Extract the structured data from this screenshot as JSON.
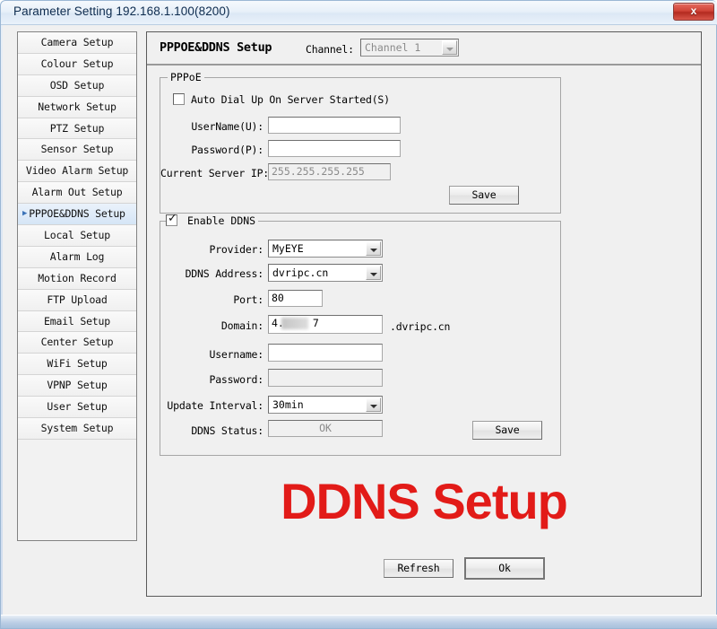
{
  "window": {
    "title": "Parameter Setting 192.168.1.100(8200)",
    "close_label": "x",
    "close_icon": "close-icon"
  },
  "sidebar": {
    "selected_index": 8,
    "marker_glyph": "▶",
    "items": [
      {
        "label": "Camera Setup"
      },
      {
        "label": "Colour Setup"
      },
      {
        "label": "OSD Setup"
      },
      {
        "label": "Network Setup"
      },
      {
        "label": "PTZ Setup"
      },
      {
        "label": "Sensor Setup"
      },
      {
        "label": "Video Alarm Setup"
      },
      {
        "label": "Alarm Out Setup"
      },
      {
        "label": "PPPOE&DDNS Setup"
      },
      {
        "label": "Local Setup"
      },
      {
        "label": "Alarm Log"
      },
      {
        "label": "Motion Record"
      },
      {
        "label": "FTP Upload"
      },
      {
        "label": "Email Setup"
      },
      {
        "label": "Center Setup"
      },
      {
        "label": "WiFi Setup"
      },
      {
        "label": "VPNP Setup"
      },
      {
        "label": "User Setup"
      },
      {
        "label": "System Setup"
      }
    ]
  },
  "content": {
    "page_title": "PPPOE&DDNS Setup",
    "channel_label": "Channel:",
    "channel_value": "Channel 1"
  },
  "pppoe": {
    "group_title": "PPPoE",
    "auto_dial_label": "Auto Dial Up On Server Started(S)",
    "auto_dial_checked": false,
    "username_label": "UserName(U):",
    "username_value": "",
    "password_label": "Password(P):",
    "password_value": "",
    "server_ip_label": "Current Server IP:",
    "server_ip_value": "255.255.255.255",
    "save_label": "Save"
  },
  "ddns": {
    "group_title": "Enable DDNS",
    "enabled": true,
    "check_glyph": "✓",
    "provider_label": "Provider:",
    "provider_value": "MyEYE",
    "address_label": "DDNS Address:",
    "address_value": "dvripc.cn",
    "port_label": "Port:",
    "port_value": "80",
    "domain_label": "Domain:",
    "domain_value_prefix": "4.",
    "domain_value_suffix": "7",
    "domain_suffix_text": ".dvripc.cn",
    "username_label": "Username:",
    "username_value": "",
    "password_label": "Password:",
    "password_value": "",
    "update_interval_label": "Update Interval:",
    "update_interval_value": "30min",
    "status_label": "DDNS Status:",
    "status_value": "OK",
    "save_label": "Save"
  },
  "annotation": {
    "text": "DDNS Setup",
    "color": "#e21b18"
  },
  "footer": {
    "refresh_label": "Refresh",
    "ok_label": "Ok"
  }
}
